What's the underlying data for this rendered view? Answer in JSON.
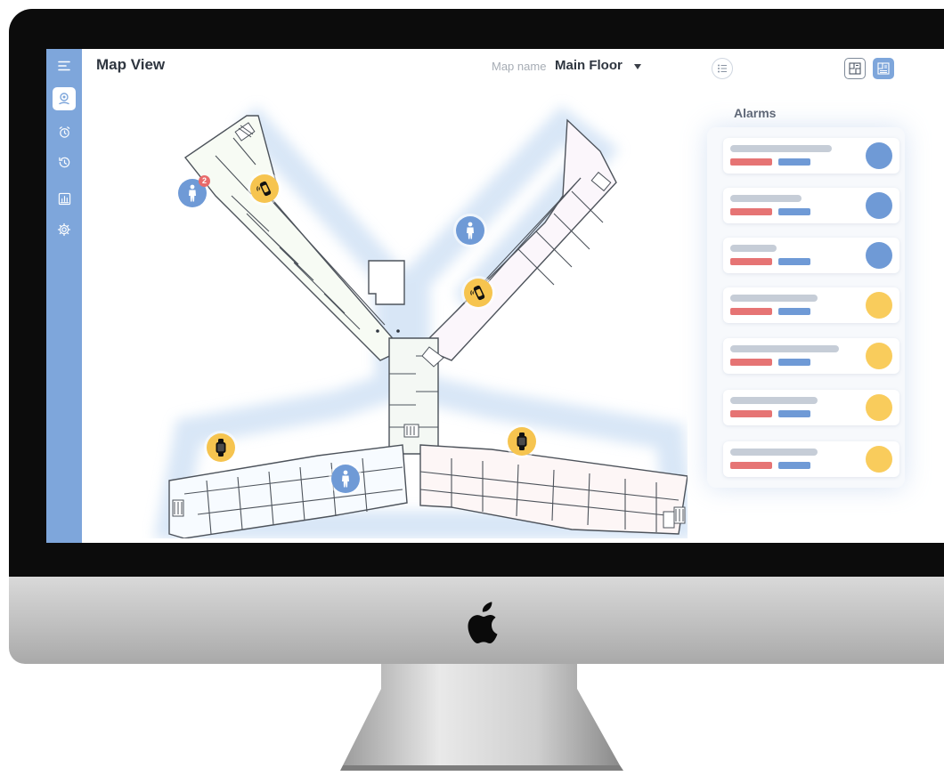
{
  "app": {
    "title": "Map View",
    "map_name_label": "Map name",
    "map_name_value": "Main Floor"
  },
  "sidebar": {
    "items": [
      {
        "name": "menu",
        "icon": "hamburger-menu-icon",
        "active": false
      },
      {
        "name": "map",
        "icon": "map-pin-icon",
        "active": true
      },
      {
        "name": "alarms",
        "icon": "alarm-clock-icon",
        "active": false
      },
      {
        "name": "history",
        "icon": "history-icon",
        "active": false
      },
      {
        "name": "reports",
        "icon": "bar-chart-icon",
        "active": false
      },
      {
        "name": "settings",
        "icon": "gear-icon",
        "active": false
      }
    ]
  },
  "toolbar": {
    "legend_icon": "list-icon",
    "views": [
      {
        "name": "floor-plan-view",
        "icon": "floor-plan-icon",
        "active": false
      },
      {
        "name": "floor-plan-list-view",
        "icon": "floor-plan-list-icon",
        "active": true
      }
    ]
  },
  "map": {
    "markers": [
      {
        "type": "person",
        "icon": "person-icon",
        "badge": "2"
      },
      {
        "type": "device",
        "icon": "smartwatch-signal-icon"
      },
      {
        "type": "person",
        "icon": "person-icon"
      },
      {
        "type": "device",
        "icon": "smartwatch-signal-icon"
      },
      {
        "type": "device",
        "icon": "smartwatch-icon"
      },
      {
        "type": "device",
        "icon": "smartwatch-icon"
      },
      {
        "type": "person",
        "icon": "person-icon"
      }
    ]
  },
  "alarms": {
    "title": "Alarms",
    "items": [
      {
        "status": "blue"
      },
      {
        "status": "blue"
      },
      {
        "status": "blue"
      },
      {
        "status": "yellow"
      },
      {
        "status": "yellow"
      },
      {
        "status": "yellow"
      },
      {
        "status": "yellow"
      }
    ]
  },
  "colors": {
    "accent": "#7ea6db",
    "person_marker": "#6f9ad6",
    "device_marker": "#f6c44f",
    "alarm_red": "#e67474",
    "alarm_blue": "#6f9ad6",
    "alarm_yellow": "#f9cc5c"
  }
}
